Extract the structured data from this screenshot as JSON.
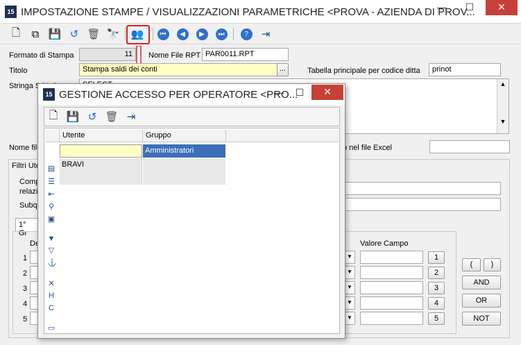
{
  "window": {
    "logo": "15",
    "title": "IMPOSTAZIONE STAMPE / VISUALIZZAZIONI PARAMETRICHE <PROVA - AZIENDA DI PROV...",
    "min_glyph": "—",
    "max_glyph": "☐",
    "close_glyph": "✕"
  },
  "toolbar": {
    "new": "🗋",
    "copy": "⧉",
    "save": "💾",
    "undo": "↺",
    "delete": "🗑",
    "find": "🔭",
    "users": "👥",
    "first": "⏮",
    "prev": "◀",
    "next": "▶",
    "last": "⏭",
    "help": "?",
    "exit": "⇥"
  },
  "form": {
    "formato_label": "Formato di Stampa",
    "formato_value": "11",
    "nome_file_rpt_label": "Nome File RPT",
    "nome_file_rpt_value": "PAR0011.RPT",
    "titolo_label": "Titolo",
    "titolo_value": "Stampa saldi dei conti",
    "titolo_btn": "...",
    "tabella_label": "Tabella principale per codice ditta",
    "tabella_value": "prinot",
    "stringa_label": "Stringa SQL Server",
    "stringa_value": "SELECT",
    "nome_file_label": "Nome file",
    "excel_label": "o nel file Excel",
    "filtri_label": "Filtri Ute",
    "comp_label": "Comp",
    "relaz_label": "relazi",
    "subq_label": "Subqu",
    "tab_label": "1° Gr",
    "de_label": "De",
    "valore_campo_label": "Valore Campo",
    "rows": [
      "1",
      "2",
      "3",
      "4",
      "5"
    ],
    "paren_open": "(",
    "paren_close": ")",
    "and_label": "AND",
    "or_label": "OR",
    "not_label": "NOT"
  },
  "dialog": {
    "logo": "15",
    "title": "GESTIONE ACCESSO PER OPERATORE <PRO...",
    "min_glyph": "—",
    "max_glyph": "☐",
    "close_glyph": "✕",
    "columns": [
      "Utente",
      "Gruppo"
    ],
    "rows": [
      {
        "utente": "",
        "gruppo": "Amministratori"
      },
      {
        "utente": "BRAVI",
        "gruppo": ""
      }
    ]
  },
  "colors": {
    "highlight": "#d6232a",
    "selected_cell": "#3c6fb8",
    "input_yellow": "#ffffc4",
    "close_red": "#c7403a"
  }
}
